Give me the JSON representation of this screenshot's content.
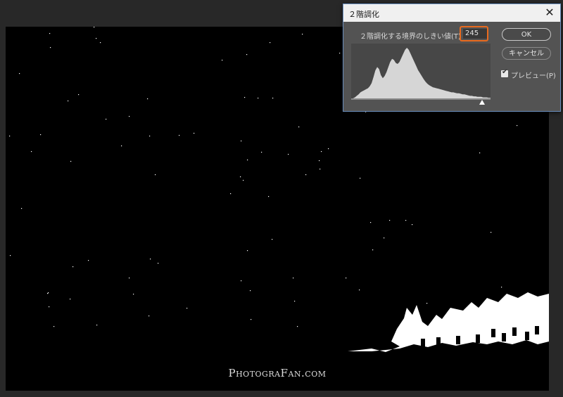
{
  "dialog": {
    "title": "２階調化",
    "close_symbol": "✕",
    "threshold_label": "２階調化する境界のしきい値(T):",
    "threshold_value": "245",
    "ok_label": "OK",
    "cancel_label": "キャンセル",
    "preview_label": "プレビュー(P)",
    "preview_checked": true,
    "highlight_color": "#e86a1e"
  },
  "histogram": {
    "levels": [
      0,
      0,
      2,
      5,
      8,
      12,
      14,
      16,
      18,
      20,
      24,
      30,
      42,
      55,
      62,
      58,
      46,
      40,
      44,
      52,
      62,
      72,
      78,
      76,
      70,
      68,
      72,
      80,
      88,
      96,
      100,
      96,
      88,
      80,
      72,
      64,
      56,
      50,
      44,
      38,
      33,
      29,
      26,
      24,
      22,
      21,
      20,
      19,
      18,
      17,
      16,
      15,
      14,
      13,
      12,
      12,
      11,
      10,
      10,
      9,
      8,
      8,
      7,
      6,
      5,
      5,
      4,
      4,
      3,
      3,
      3,
      2,
      2,
      2,
      1,
      1
    ]
  },
  "image": {
    "watermark": "PhotograFan.com"
  }
}
